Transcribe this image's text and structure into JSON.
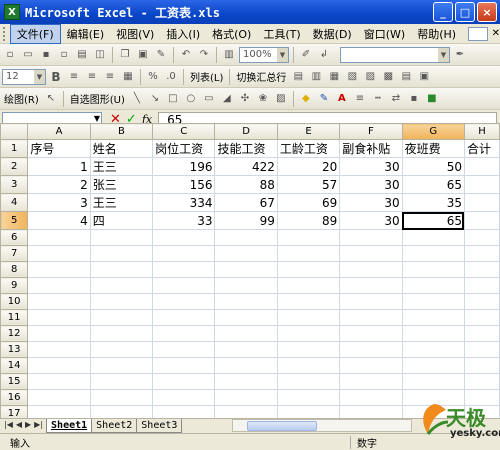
{
  "window": {
    "title": "Microsoft Excel - 工资表.xls",
    "app_icon": "X",
    "min": "_",
    "max": "□",
    "close": "×"
  },
  "menu": {
    "items": [
      "文件(F)",
      "编辑(E)",
      "视图(V)",
      "插入(I)",
      "格式(O)",
      "工具(T)",
      "数据(D)",
      "窗口(W)",
      "帮助(H)"
    ]
  },
  "toolbar1": {
    "zoom": "100%"
  },
  "toolbar2": {
    "font_size": "12",
    "bold": "B",
    "list": "列表(L)",
    "toggle_total": "切换汇总行"
  },
  "toolbar3": {
    "draw": "绘图(R)",
    "autoshape": "自选图形(U)"
  },
  "formula": {
    "cell": "",
    "value": "65",
    "cancel": "✕",
    "enter": "✓",
    "fx": "fx"
  },
  "grid": {
    "columns": [
      "A",
      "B",
      "C",
      "D",
      "E",
      "F",
      "G",
      "H"
    ],
    "active_col": "G",
    "active_row": 5,
    "rows": [
      [
        "序号",
        "姓名",
        "岗位工资",
        "技能工资",
        "工龄工资",
        "副食补贴",
        "夜班费",
        "合计"
      ],
      [
        "1",
        "王三",
        "196",
        "422",
        "20",
        "30",
        "50",
        ""
      ],
      [
        "2",
        "张三",
        "156",
        "88",
        "57",
        "30",
        "65",
        ""
      ],
      [
        "3",
        "王三",
        "334",
        "67",
        "69",
        "30",
        "35",
        ""
      ],
      [
        "4",
        "四",
        "33",
        "99",
        "89",
        "30",
        "65",
        ""
      ],
      [
        "",
        "",
        "",
        "",
        "",
        "",
        "",
        ""
      ],
      [
        "",
        "",
        "",
        "",
        "",
        "",
        "",
        ""
      ],
      [
        "",
        "",
        "",
        "",
        "",
        "",
        "",
        ""
      ],
      [
        "",
        "",
        "",
        "",
        "",
        "",
        "",
        ""
      ],
      [
        "",
        "",
        "",
        "",
        "",
        "",
        "",
        ""
      ],
      [
        "",
        "",
        "",
        "",
        "",
        "",
        "",
        ""
      ],
      [
        "",
        "",
        "",
        "",
        "",
        "",
        "",
        ""
      ],
      [
        "",
        "",
        "",
        "",
        "",
        "",
        "",
        ""
      ],
      [
        "",
        "",
        "",
        "",
        "",
        "",
        "",
        ""
      ],
      [
        "",
        "",
        "",
        "",
        "",
        "",
        "",
        ""
      ],
      [
        "",
        "",
        "",
        "",
        "",
        "",
        "",
        ""
      ],
      [
        "",
        "",
        "",
        "",
        "",
        "",
        "",
        ""
      ],
      [
        "",
        "",
        "",
        "",
        "",
        "",
        "",
        ""
      ]
    ]
  },
  "sheets": {
    "tabs": [
      "Sheet1",
      "Sheet2",
      "Sheet3"
    ],
    "active": "Sheet1"
  },
  "status": {
    "mode": "输入",
    "num": "数字"
  },
  "watermark": {
    "text": "天极",
    "sub": "yesky.com"
  }
}
